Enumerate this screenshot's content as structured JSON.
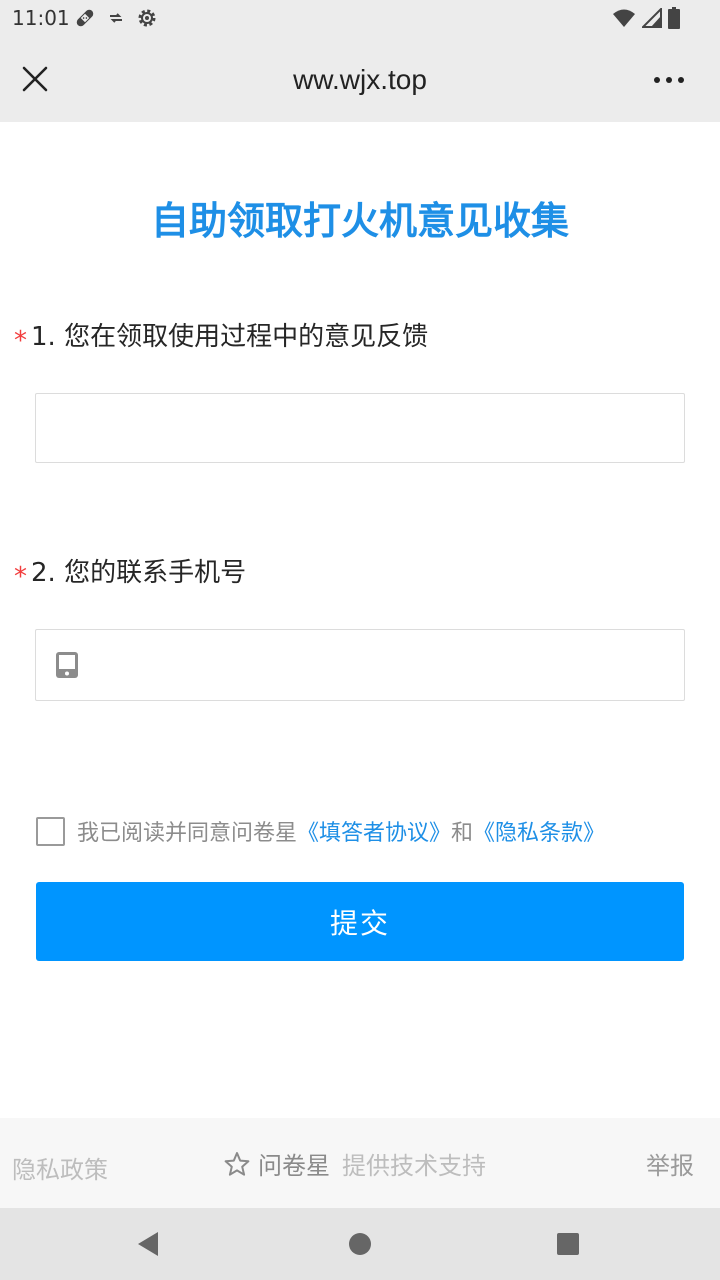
{
  "status_bar": {
    "time": "11:01",
    "left_icons": [
      "bandage-icon",
      "data-sync-icon",
      "settings-gear-icon"
    ],
    "right_icons": [
      "wifi-icon",
      "cell-signal-icon",
      "battery-icon"
    ]
  },
  "title_bar": {
    "close_icon": "close-icon",
    "url": "ww.wjx.top",
    "more_icon": "more-dots-icon"
  },
  "survey": {
    "title": "自助领取打火机意见收集",
    "questions": [
      {
        "required_mark": "*",
        "label": "1. 您在领取使用过程中的意见反馈",
        "value": ""
      },
      {
        "required_mark": "*",
        "label": "2. 您的联系手机号",
        "value": "",
        "icon": "mobile-phone-icon"
      }
    ],
    "agreement": {
      "text": "我已阅读并同意问卷星",
      "link1": "《填答者协议》",
      "and": "和",
      "link2": "《隐私条款》"
    },
    "submit_label": "提交"
  },
  "footer": {
    "privacy": "隐私政策",
    "brand": "问卷星",
    "support": "提供技术支持",
    "report": "举报"
  },
  "colors": {
    "accent": "#0095ff",
    "title_blue": "#1e8fe6",
    "required_red": "#f23d3d"
  }
}
